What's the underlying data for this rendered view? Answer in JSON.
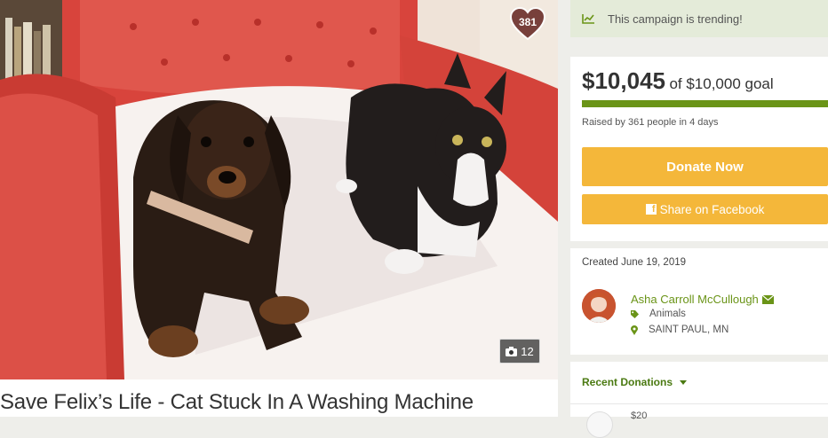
{
  "campaign": {
    "title": "Save Felix’s Life - Cat Stuck In A Washing Machine",
    "heart_count": "381",
    "photo_count": "12"
  },
  "trending": {
    "icon": "trend-chart-icon",
    "text": "This campaign is trending!"
  },
  "funds": {
    "raised": "$10,045",
    "goal_text": "of $10,000 goal",
    "progress_fraction": 1.0,
    "meta": "Raised by 361 people in 4 days"
  },
  "actions": {
    "donate_label": "Donate Now",
    "share_label": "Share on Facebook"
  },
  "organizer": {
    "created": "Created June 19, 2019",
    "name": "Asha Carroll McCullough",
    "category": "Animals",
    "location": "SAINT PAUL, MN"
  },
  "donations": {
    "label": "Recent Donations",
    "peek_amount": "$20"
  },
  "colors": {
    "accent_green": "#6a9417",
    "button_yellow": "#f4b73a",
    "trend_bg": "#e4ebd9"
  }
}
